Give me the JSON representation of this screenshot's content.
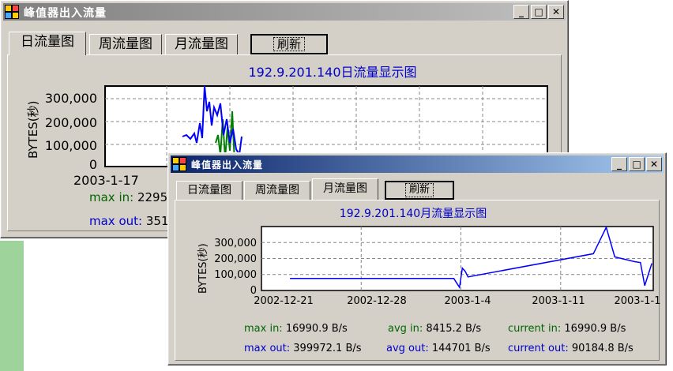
{
  "window_title": "峰值器出入流量",
  "back": {
    "tabs": [
      "日流量图",
      "周流量图",
      "月流量图"
    ],
    "refresh": "刷新",
    "chart_title": "192.9.201.140日流量显示图",
    "ylabel": "BYTES(秒)",
    "yticks": [
      "300,000",
      "200,000",
      "100,000",
      "0"
    ],
    "xtick": "2003-1-17",
    "max_in_label": "max in:",
    "max_in_value": "2295",
    "max_out_label": "max out:",
    "max_out_value": "351"
  },
  "front": {
    "tabs": [
      "日流量图",
      "周流量图",
      "月流量图"
    ],
    "refresh": "刷新",
    "stats": {
      "max_in_label": "max in:",
      "max_in_value": "16990.9 B/s",
      "avg_in_label": "avg in:",
      "avg_in_value": "8415.2 B/s",
      "cur_in_label": "current in:",
      "cur_in_value": "16990.9 B/s",
      "max_out_label": "max out:",
      "max_out_value": "399972.1 B/s",
      "avg_out_label": "avg out:",
      "avg_out_value": "144701 B/s",
      "cur_out_label": "current out:",
      "cur_out_value": "90184.8 B/s"
    }
  },
  "colors": {
    "title_start": "#0a246a",
    "title_end": "#a6caf0",
    "line_in": "#008000",
    "line_out": "#0000ff"
  },
  "chart_data": {
    "type": "line",
    "title": "192.9.201.140月流量显示图",
    "ylabel": "BYTES(秒)",
    "x_tick_labels": [
      "2002-12-21",
      "2002-12-28",
      "2003-1-4",
      "2003-1-11",
      "2003-1-1"
    ],
    "y_tick_labels": [
      "300,000",
      "200,000",
      "100,000",
      "0"
    ],
    "ylim": [
      0,
      400000
    ],
    "xlim_days": [
      0,
      27.5
    ],
    "grid": true,
    "series": [
      {
        "name": "out",
        "points": [
          [
            2,
            75000
          ],
          [
            13.5,
            75000
          ],
          [
            13.9,
            20000
          ],
          [
            14.1,
            140000
          ],
          [
            14.3,
            120000
          ],
          [
            14.5,
            85000
          ],
          [
            23.3,
            230000
          ],
          [
            24.2,
            395000
          ],
          [
            24.8,
            210000
          ],
          [
            26.2,
            180000
          ],
          [
            26.6,
            175000
          ],
          [
            26.9,
            30000
          ],
          [
            27.4,
            170000
          ]
        ]
      }
    ]
  }
}
